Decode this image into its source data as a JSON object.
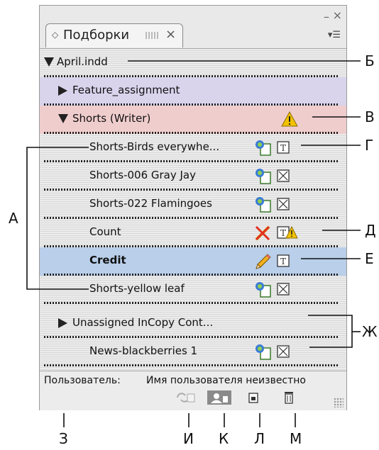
{
  "panel": {
    "tab_label": "Подборки",
    "items": [
      {
        "label": "April.indd",
        "type": "document"
      },
      {
        "label": "Feature_assignment",
        "type": "assignment"
      },
      {
        "label": "Shorts (Writer)",
        "type": "assignment"
      },
      {
        "label": "Shorts-Birds everywhe...",
        "type": "story"
      },
      {
        "label": "Shorts-006 Gray Jay",
        "type": "story"
      },
      {
        "label": "Shorts-022 Flamingoes",
        "type": "story"
      },
      {
        "label": "Count",
        "type": "story"
      },
      {
        "label": "Credit",
        "type": "story"
      },
      {
        "label": "Shorts-yellow leaf",
        "type": "story"
      },
      {
        "label": "Unassigned InCopy Cont...",
        "type": "group"
      },
      {
        "label": "News-blackberries 1",
        "type": "story"
      }
    ],
    "status_label": "Пользователь:",
    "status_value": "Имя пользователя неизвестно"
  },
  "callouts": {
    "a": "А",
    "b": "Б",
    "v": "В",
    "g": "Г",
    "d": "Д",
    "e": "Е",
    "zh": "Ж",
    "z": "З",
    "i": "И",
    "k": "К",
    "l": "Л",
    "m": "М"
  },
  "colors": {
    "row_purple": "#d9d3ec",
    "row_pink": "#f0cdcd",
    "row_blue": "#b9cfea",
    "warning": "#f2c200",
    "conflict_x": "#e03020"
  },
  "icons": [
    "collapse-triangle",
    "expand-triangle",
    "warning-icon",
    "out-of-date-icon",
    "editing-conflict-icon",
    "pencil-icon",
    "text-frame-icon",
    "graphics-frame-icon",
    "panel-menu-icon",
    "update-icon",
    "check-out-icon",
    "open-icon",
    "trash-icon"
  ]
}
